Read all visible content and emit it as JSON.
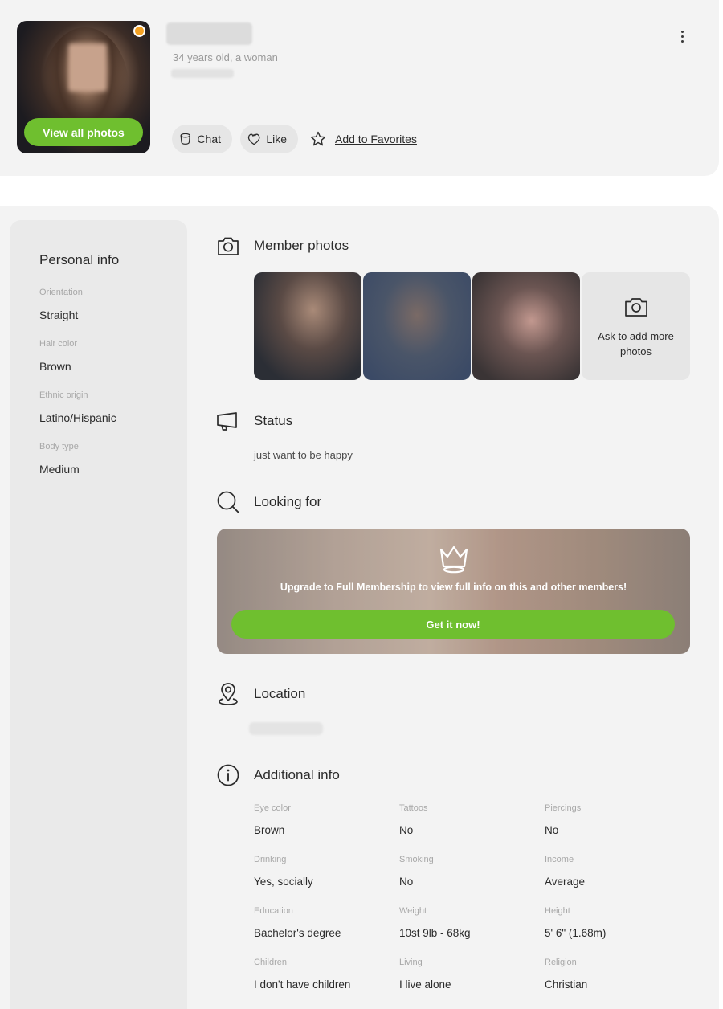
{
  "profile": {
    "age_line": "34 years old, a woman",
    "view_photos_label": "View all photos",
    "actions": {
      "chat_label": "Chat",
      "like_label": "Like",
      "favorites_label": "Add to Favorites"
    },
    "online_color": "#f4a224"
  },
  "sidebar": {
    "title": "Personal info",
    "items": [
      {
        "label": "Orientation",
        "value": "Straight"
      },
      {
        "label": "Hair color",
        "value": "Brown"
      },
      {
        "label": "Ethnic origin",
        "value": "Latino/Hispanic"
      },
      {
        "label": "Body type",
        "value": "Medium"
      }
    ]
  },
  "sections": {
    "photos": {
      "title": "Member photos",
      "ask_label": "Ask to add more photos"
    },
    "status": {
      "title": "Status",
      "text": "just want to be happy"
    },
    "looking_for": {
      "title": "Looking for",
      "upgrade_text": "Upgrade to Full Membership to view full info on this and other members!",
      "cta_label": "Get it now!"
    },
    "location": {
      "title": "Location"
    },
    "additional": {
      "title": "Additional info",
      "items": [
        {
          "label": "Eye color",
          "value": "Brown"
        },
        {
          "label": "Tattoos",
          "value": "No"
        },
        {
          "label": "Piercings",
          "value": "No"
        },
        {
          "label": "Drinking",
          "value": "Yes, socially"
        },
        {
          "label": "Smoking",
          "value": "No"
        },
        {
          "label": "Income",
          "value": "Average"
        },
        {
          "label": "Education",
          "value": "Bachelor's degree"
        },
        {
          "label": "Weight",
          "value": "10st 9lb - 68kg"
        },
        {
          "label": "Height",
          "value": "5' 6\" (1.68m)"
        },
        {
          "label": "Children",
          "value": "I don't have children"
        },
        {
          "label": "Living",
          "value": "I live alone"
        },
        {
          "label": "Religion",
          "value": "Christian"
        }
      ]
    }
  },
  "colors": {
    "accent_green": "#6fbf2f",
    "panel_bg": "#f3f3f3",
    "sidebar_bg": "#eaeaea"
  }
}
